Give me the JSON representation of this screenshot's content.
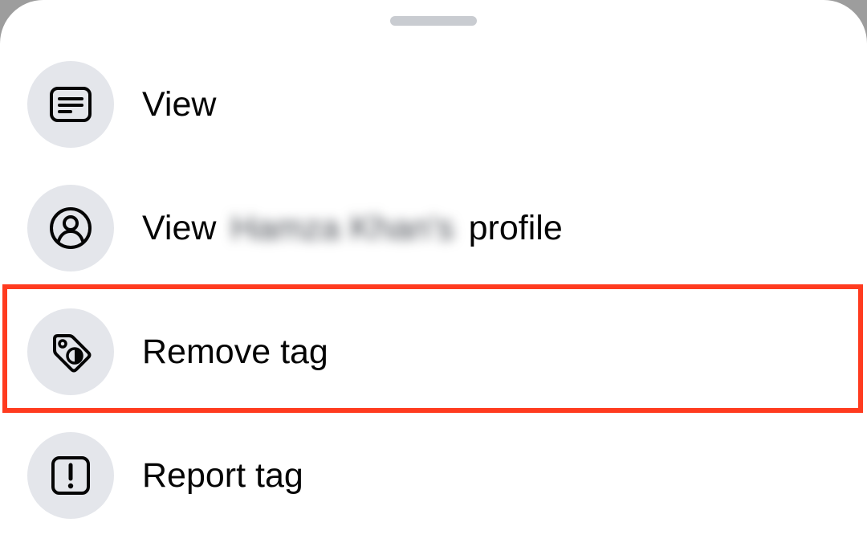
{
  "sheet": {
    "items": [
      {
        "label": "View",
        "icon": "document-text-icon"
      },
      {
        "label_prefix": "View",
        "label_blurred": "Hamza Khan's",
        "label_suffix": "profile",
        "icon": "person-circle-icon"
      },
      {
        "label": "Remove tag",
        "icon": "tag-remove-icon"
      },
      {
        "label": "Report tag",
        "icon": "exclamation-box-icon"
      }
    ]
  },
  "colors": {
    "icon_circle": "#e4e6eb",
    "text": "#050505",
    "highlight": "#ff3b1f",
    "grabber": "#c9ccd1"
  }
}
